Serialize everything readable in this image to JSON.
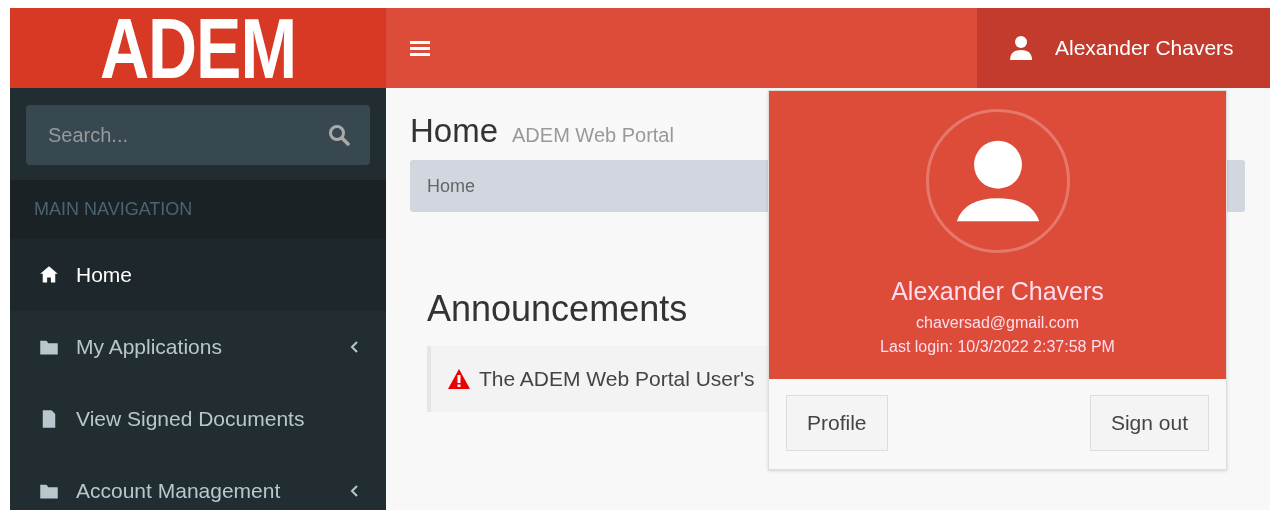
{
  "logo": {
    "text": "ADEM"
  },
  "header": {
    "user_name": "Alexander Chavers"
  },
  "sidebar": {
    "search": {
      "placeholder": "Search..."
    },
    "section_label": "MAIN NAVIGATION",
    "items": [
      {
        "label": "Home",
        "kind": "home",
        "selected": true,
        "has_submenu": false
      },
      {
        "label": "My Applications",
        "kind": "folder",
        "selected": false,
        "has_submenu": true
      },
      {
        "label": "View Signed Documents",
        "kind": "file",
        "selected": false,
        "has_submenu": false
      },
      {
        "label": "Account Management",
        "kind": "folder",
        "selected": false,
        "has_submenu": true
      }
    ]
  },
  "page": {
    "title": "Home",
    "subtitle": "ADEM Web Portal",
    "breadcrumb": [
      "Home"
    ],
    "section_title": "Announcements",
    "announcement": "The ADEM Web Portal User's"
  },
  "user_menu": {
    "name": "Alexander Chavers",
    "email": "chaversad@gmail.com",
    "last_login": "Last login: 10/3/2022 2:37:58 PM",
    "buttons": [
      "Profile",
      "Sign out"
    ]
  }
}
